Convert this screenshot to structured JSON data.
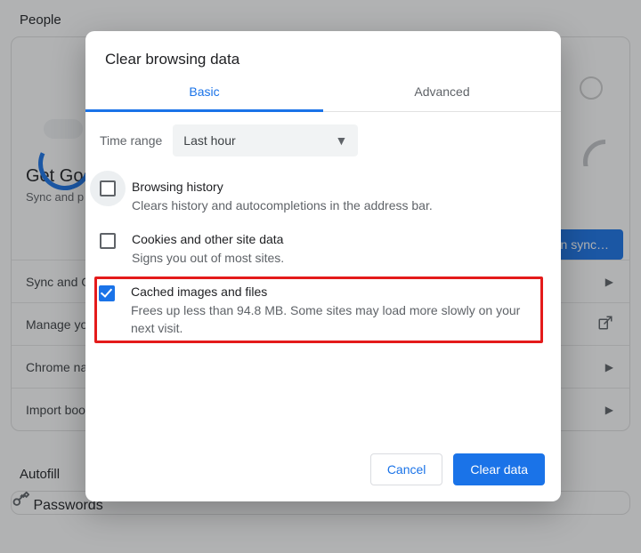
{
  "page": {
    "section_people": "People",
    "promo_title": "Get Goo",
    "promo_sub": "Sync and p",
    "cta_label": "n sync…",
    "rows": [
      {
        "label": "Sync and G",
        "trailing": "chevron"
      },
      {
        "label": "Manage yo",
        "trailing": "ext"
      },
      {
        "label": "Chrome na",
        "trailing": "chevron"
      },
      {
        "label": "Import boo",
        "trailing": "chevron"
      }
    ],
    "section_autofill": "Autofill",
    "autofill_item": "Passwords"
  },
  "dialog": {
    "title": "Clear browsing data",
    "tabs": {
      "basic": "Basic",
      "advanced": "Advanced"
    },
    "time_range_label": "Time range",
    "time_range_value": "Last hour",
    "opts": [
      {
        "title": "Browsing history",
        "desc": "Clears history and autocompletions in the address bar.",
        "checked": false,
        "focused": true
      },
      {
        "title": "Cookies and other site data",
        "desc": "Signs you out of most sites.",
        "checked": false,
        "focused": false
      },
      {
        "title": "Cached images and files",
        "desc": "Frees up less than 94.8 MB. Some sites may load more slowly on your next visit.",
        "checked": true,
        "focused": false,
        "highlighted": true
      }
    ],
    "buttons": {
      "cancel": "Cancel",
      "clear": "Clear data"
    }
  }
}
